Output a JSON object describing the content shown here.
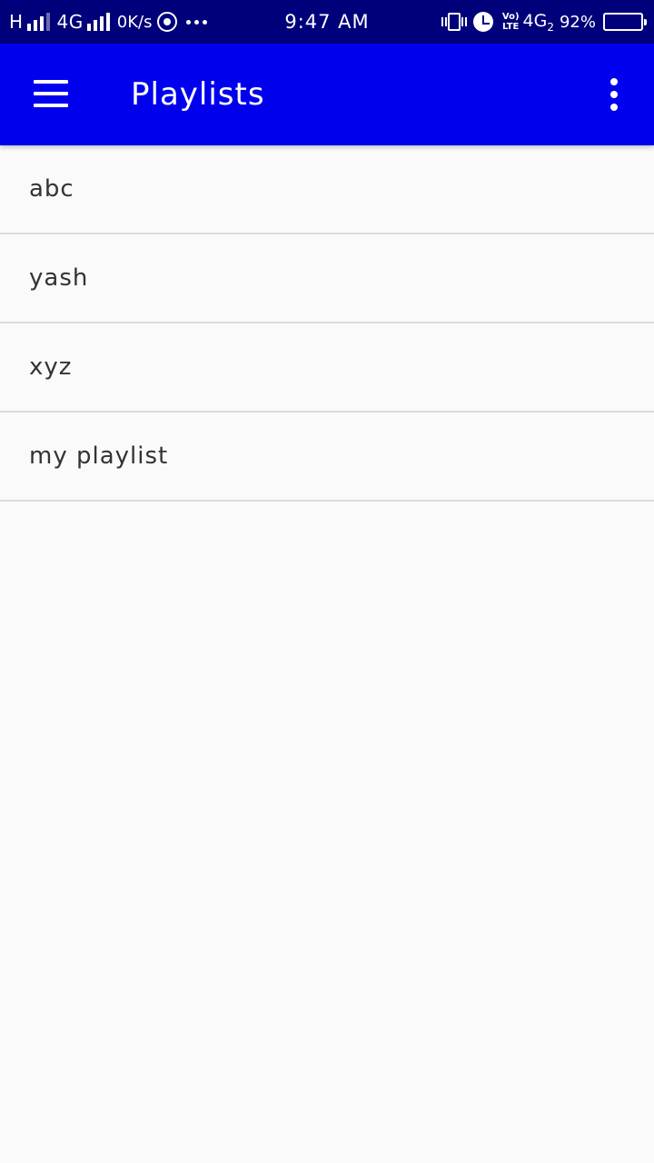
{
  "status_bar": {
    "network_h": "H",
    "network_4g": "4G",
    "speed": "0K/s",
    "time": "9:47 AM",
    "volte_top": "Vo)",
    "volte_bottom": "LTE",
    "network_4g2": "4G",
    "sim_index": "2",
    "battery": "92%",
    "battery_level": 0.92,
    "icons": [
      "signal-icon",
      "signal-icon",
      "whatsapp-icon",
      "more-notifications-icon",
      "vibrate-icon",
      "alarm-icon",
      "battery-icon"
    ]
  },
  "app_bar": {
    "title": "Playlists",
    "background": "#0000ee",
    "icons": [
      "menu-icon",
      "overflow-menu-icon"
    ]
  },
  "playlists": [
    {
      "name": "abc"
    },
    {
      "name": "yash"
    },
    {
      "name": "xyz"
    },
    {
      "name": "my playlist"
    }
  ]
}
